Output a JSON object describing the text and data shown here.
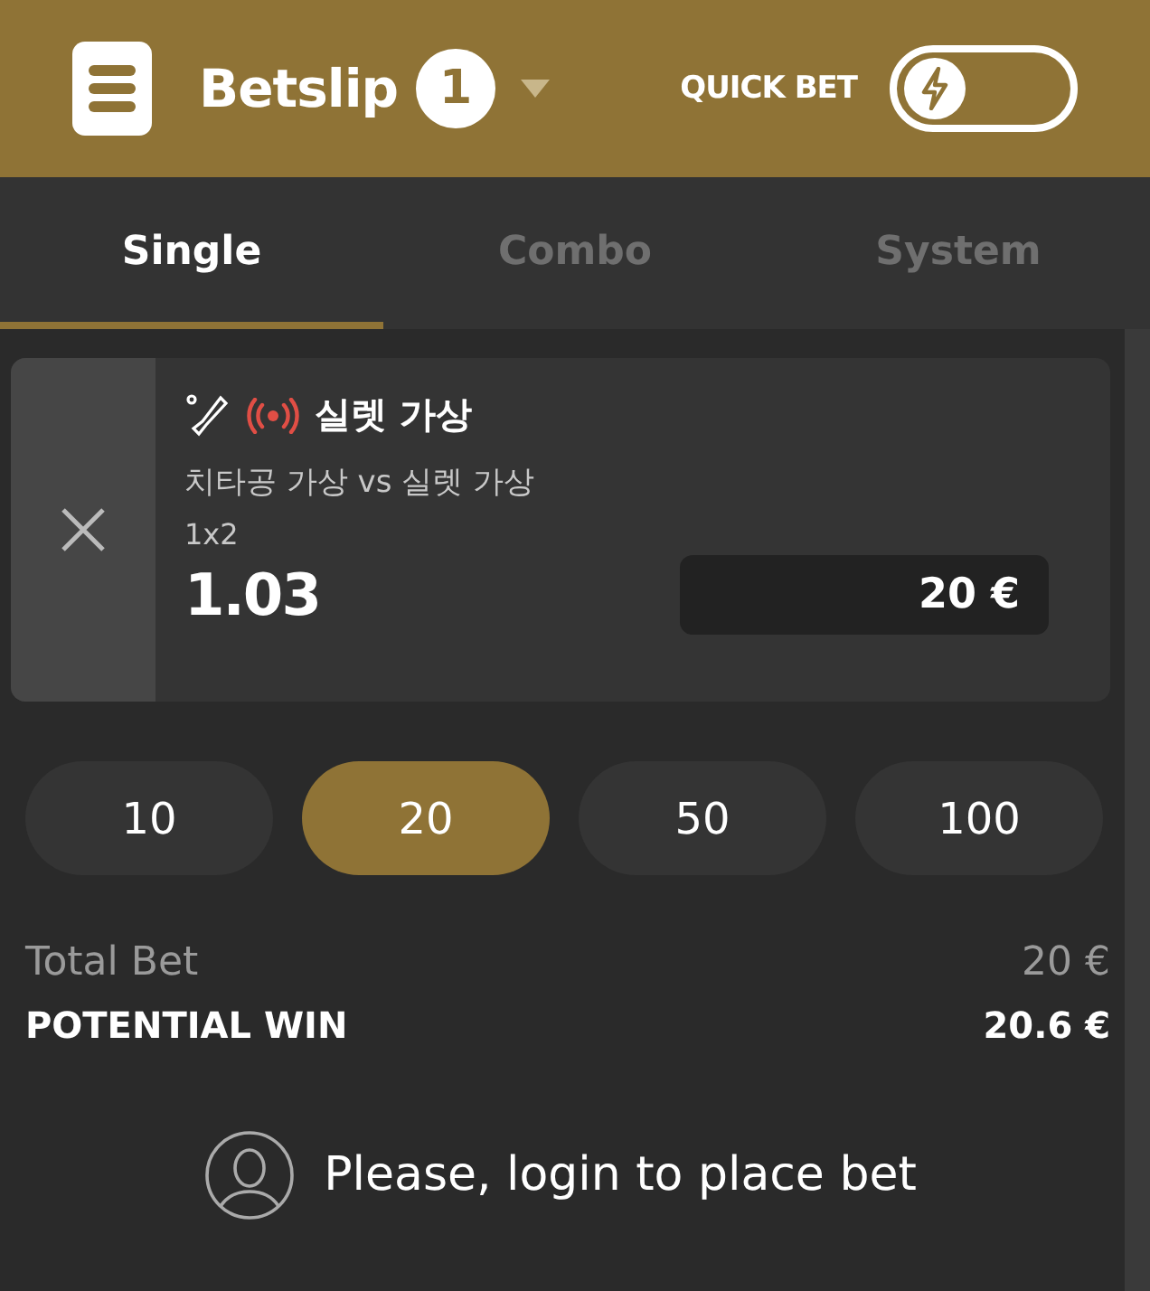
{
  "header": {
    "title": "Betslip",
    "count": "1",
    "quick_bet": {
      "label": "QUICK BET",
      "on": false
    }
  },
  "tabs": [
    {
      "label": "Single",
      "selected": true
    },
    {
      "label": "Combo",
      "selected": false
    },
    {
      "label": "System",
      "selected": false
    }
  ],
  "bet": {
    "live": true,
    "selection": "실렛 가상",
    "event": "치타공 가상 vs 실렛 가상",
    "market": "1x2",
    "odds": "1.03",
    "stake": "20 €"
  },
  "stakes": [
    {
      "label": "10",
      "selected": false
    },
    {
      "label": "20",
      "selected": true
    },
    {
      "label": "50",
      "selected": false
    },
    {
      "label": "100",
      "selected": false
    }
  ],
  "totals": {
    "total_bet_label": "Total Bet",
    "total_bet": "20 €",
    "potential_win_label": "POTENTIAL WIN",
    "potential_win": "20.6 €"
  },
  "login": "Please, login to place bet"
}
